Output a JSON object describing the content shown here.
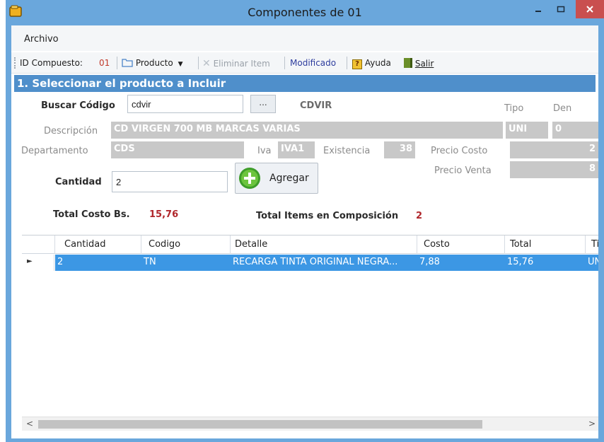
{
  "window": {
    "title": "Componentes de 01",
    "minimize_icon": "minimize-icon",
    "maximize_icon": "maximize-icon",
    "close_icon": "close-icon"
  },
  "menu": {
    "archivo": "Archivo"
  },
  "toolbar": {
    "id_label": "ID Compuesto:",
    "id_value": "01",
    "producto": "Producto",
    "eliminar": "Eliminar Item",
    "modificado": "Modificado",
    "ayuda": "Ayuda",
    "salir": "Salir"
  },
  "section": {
    "title": "1. Seleccionar el producto a Incluir"
  },
  "form": {
    "buscar_label": "Buscar Código",
    "buscar_value": "cdvir",
    "browse_label": "...",
    "code_display": "CDVIR",
    "tipo_label": "Tipo",
    "den_label": "Den",
    "descripcion_label": "Descripción",
    "descripcion_value": "CD VIRGEN 700 MB MARCAS VARIAS",
    "tipo_value": "UNI",
    "den_value": "0",
    "departamento_label": "Departamento",
    "departamento_value": "CDS",
    "iva_label": "Iva",
    "iva_value": "IVA1",
    "existencia_label": "Existencia",
    "existencia_value": "38",
    "precio_costo_label": "Precio Costo",
    "precio_costo_value": "2",
    "precio_venta_label": "Precio Venta",
    "precio_venta_value": "8",
    "cantidad_label": "Cantidad",
    "cantidad_value": "2",
    "agregar_label": "Agregar"
  },
  "totals": {
    "costo_label": "Total Costo Bs.",
    "costo_value": "15,76",
    "items_label": "Total Items en Composición",
    "items_value": "2"
  },
  "grid": {
    "columns": [
      "Cantidad",
      "Codigo",
      "Detalle",
      "Costo",
      "Total",
      "Tip"
    ],
    "rows": [
      [
        "2",
        "TN",
        "RECARGA TINTA ORIGINAL NEGRA...",
        "7,88",
        "15,76",
        "UN"
      ]
    ]
  },
  "colors": {
    "title_bar": "#6aa7dc",
    "section_header": "#4f8fcb",
    "selection": "#3c97e4",
    "total_red": "#b0272c"
  }
}
